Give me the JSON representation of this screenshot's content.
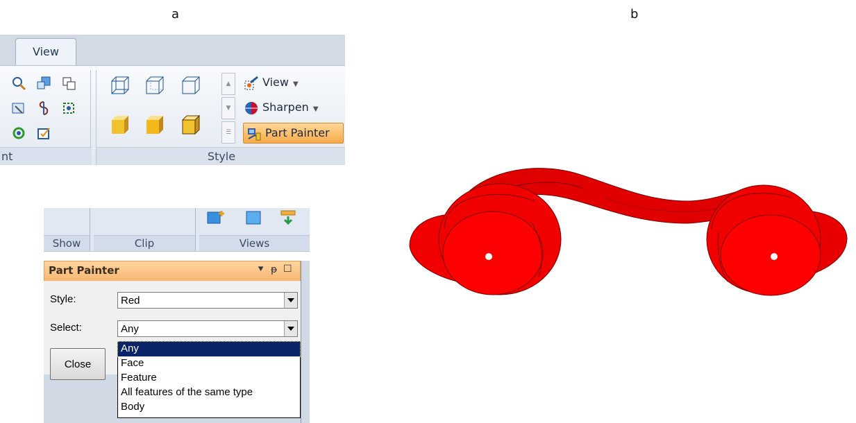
{
  "panels": {
    "a": "a",
    "b": "b"
  },
  "ribbon": {
    "tab": "View",
    "left_group_caption": "nt",
    "style_group_caption": "Style",
    "commands": [
      {
        "label": "View",
        "icon": "view-icon"
      },
      {
        "label": "Sharpen",
        "icon": "sharpen-icon"
      },
      {
        "label": "Part Painter",
        "icon": "part-painter-icon"
      }
    ]
  },
  "views_strip": {
    "groups": [
      "Show",
      "Clip",
      "Views"
    ]
  },
  "part_painter": {
    "title": "Part Painter",
    "style_label": "Style:",
    "style_value": "Red",
    "select_label": "Select:",
    "select_value": "Any",
    "close_label": "Close",
    "select_options": [
      "Any",
      "Face",
      "Feature",
      "All features of the same type",
      "Body"
    ],
    "selected_option": "Any"
  },
  "colors": {
    "part_color": "#ff0000",
    "highlight": "#f8a94a",
    "selection": "#0a246a"
  }
}
